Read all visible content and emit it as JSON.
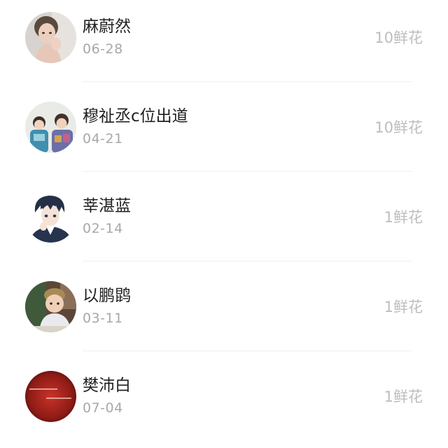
{
  "contacts": [
    {
      "name": "麻蔚然",
      "date": "06-28",
      "flowers": "10鲜花",
      "avatar_icon": "girl-portrait-avatar"
    },
    {
      "name": "穆祉丞c位出道",
      "date": "04-21",
      "flowers": "10鲜花",
      "avatar_icon": "two-kids-avatar"
    },
    {
      "name": "莘湛蓝",
      "date": "02-14",
      "flowers": "1鲜花",
      "avatar_icon": "anime-boy-avatar"
    },
    {
      "name": "以鹏鹍",
      "date": "03-11",
      "flowers": "1鲜花",
      "avatar_icon": "baby-photo-avatar"
    },
    {
      "name": "樊沛白",
      "date": "07-04",
      "flowers": "1鲜花",
      "avatar_icon": "red-text-avatar"
    }
  ],
  "colors": {
    "name_text": "#1f1f1f",
    "date_text": "#a8a8a8",
    "flowers_text": "#bdbdbd",
    "divider": "#f0f0f0"
  }
}
